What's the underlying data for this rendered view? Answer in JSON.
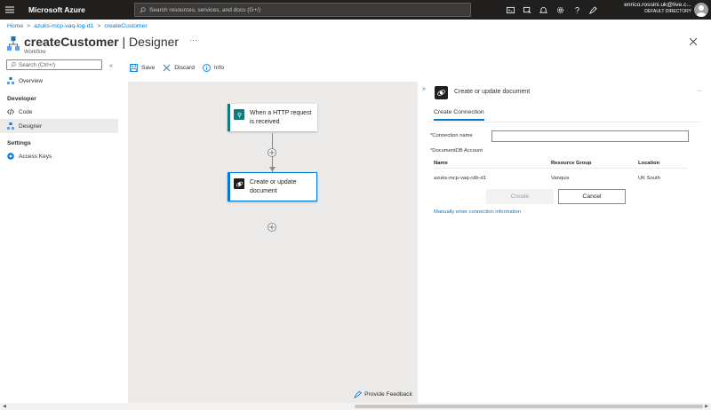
{
  "topbar": {
    "brand": "Microsoft Azure",
    "search_placeholder": "Search resources, services, and docs (G+/)",
    "account_name": "enrico.rossini.uk@live.c...",
    "account_directory": "DEFAULT DIRECTORY"
  },
  "breadcrumb": [
    "Home",
    "azuks-mcp-vaq-log-d1",
    "createCustomer"
  ],
  "blade": {
    "title_bold": "createCustomer",
    "title_rest": " | Designer",
    "subtitle": "Workflow",
    "ellipsis": "···"
  },
  "sidebar": {
    "search_placeholder": "Search (Ctrl+/)",
    "collapse": "«",
    "items": [
      {
        "label": "Overview"
      },
      {
        "label": "Code"
      },
      {
        "label": "Designer"
      },
      {
        "label": "Access Keys"
      }
    ],
    "sections": [
      "Developer",
      "Settings"
    ]
  },
  "toolbar": {
    "save": "Save",
    "discard": "Discard",
    "info": "Info"
  },
  "canvas": {
    "trigger_label": "When a HTTP request is received",
    "action_label": "Create or update document",
    "feedback": "Provide Feedback"
  },
  "panel": {
    "expand": "»",
    "title": "Create or update document",
    "menu": "···",
    "tab": "Create Connection",
    "connection_name_label": "Connection name",
    "account_label": "DocumentDB Account",
    "required_mark": "*",
    "table": {
      "headers": [
        "Name",
        "Resource Group",
        "Location"
      ],
      "rows": [
        [
          "azuks-mcp-vaq-cdb-d1",
          "Vanquis",
          "UK South"
        ]
      ]
    },
    "create": "Create",
    "cancel": "Cancel",
    "manual_link": "Manually enter connection information"
  },
  "colors": {
    "accent": "#0078d4",
    "topbar": "#201f1e",
    "trigger": "#0f7b7c",
    "canvas": "#edebe9"
  }
}
